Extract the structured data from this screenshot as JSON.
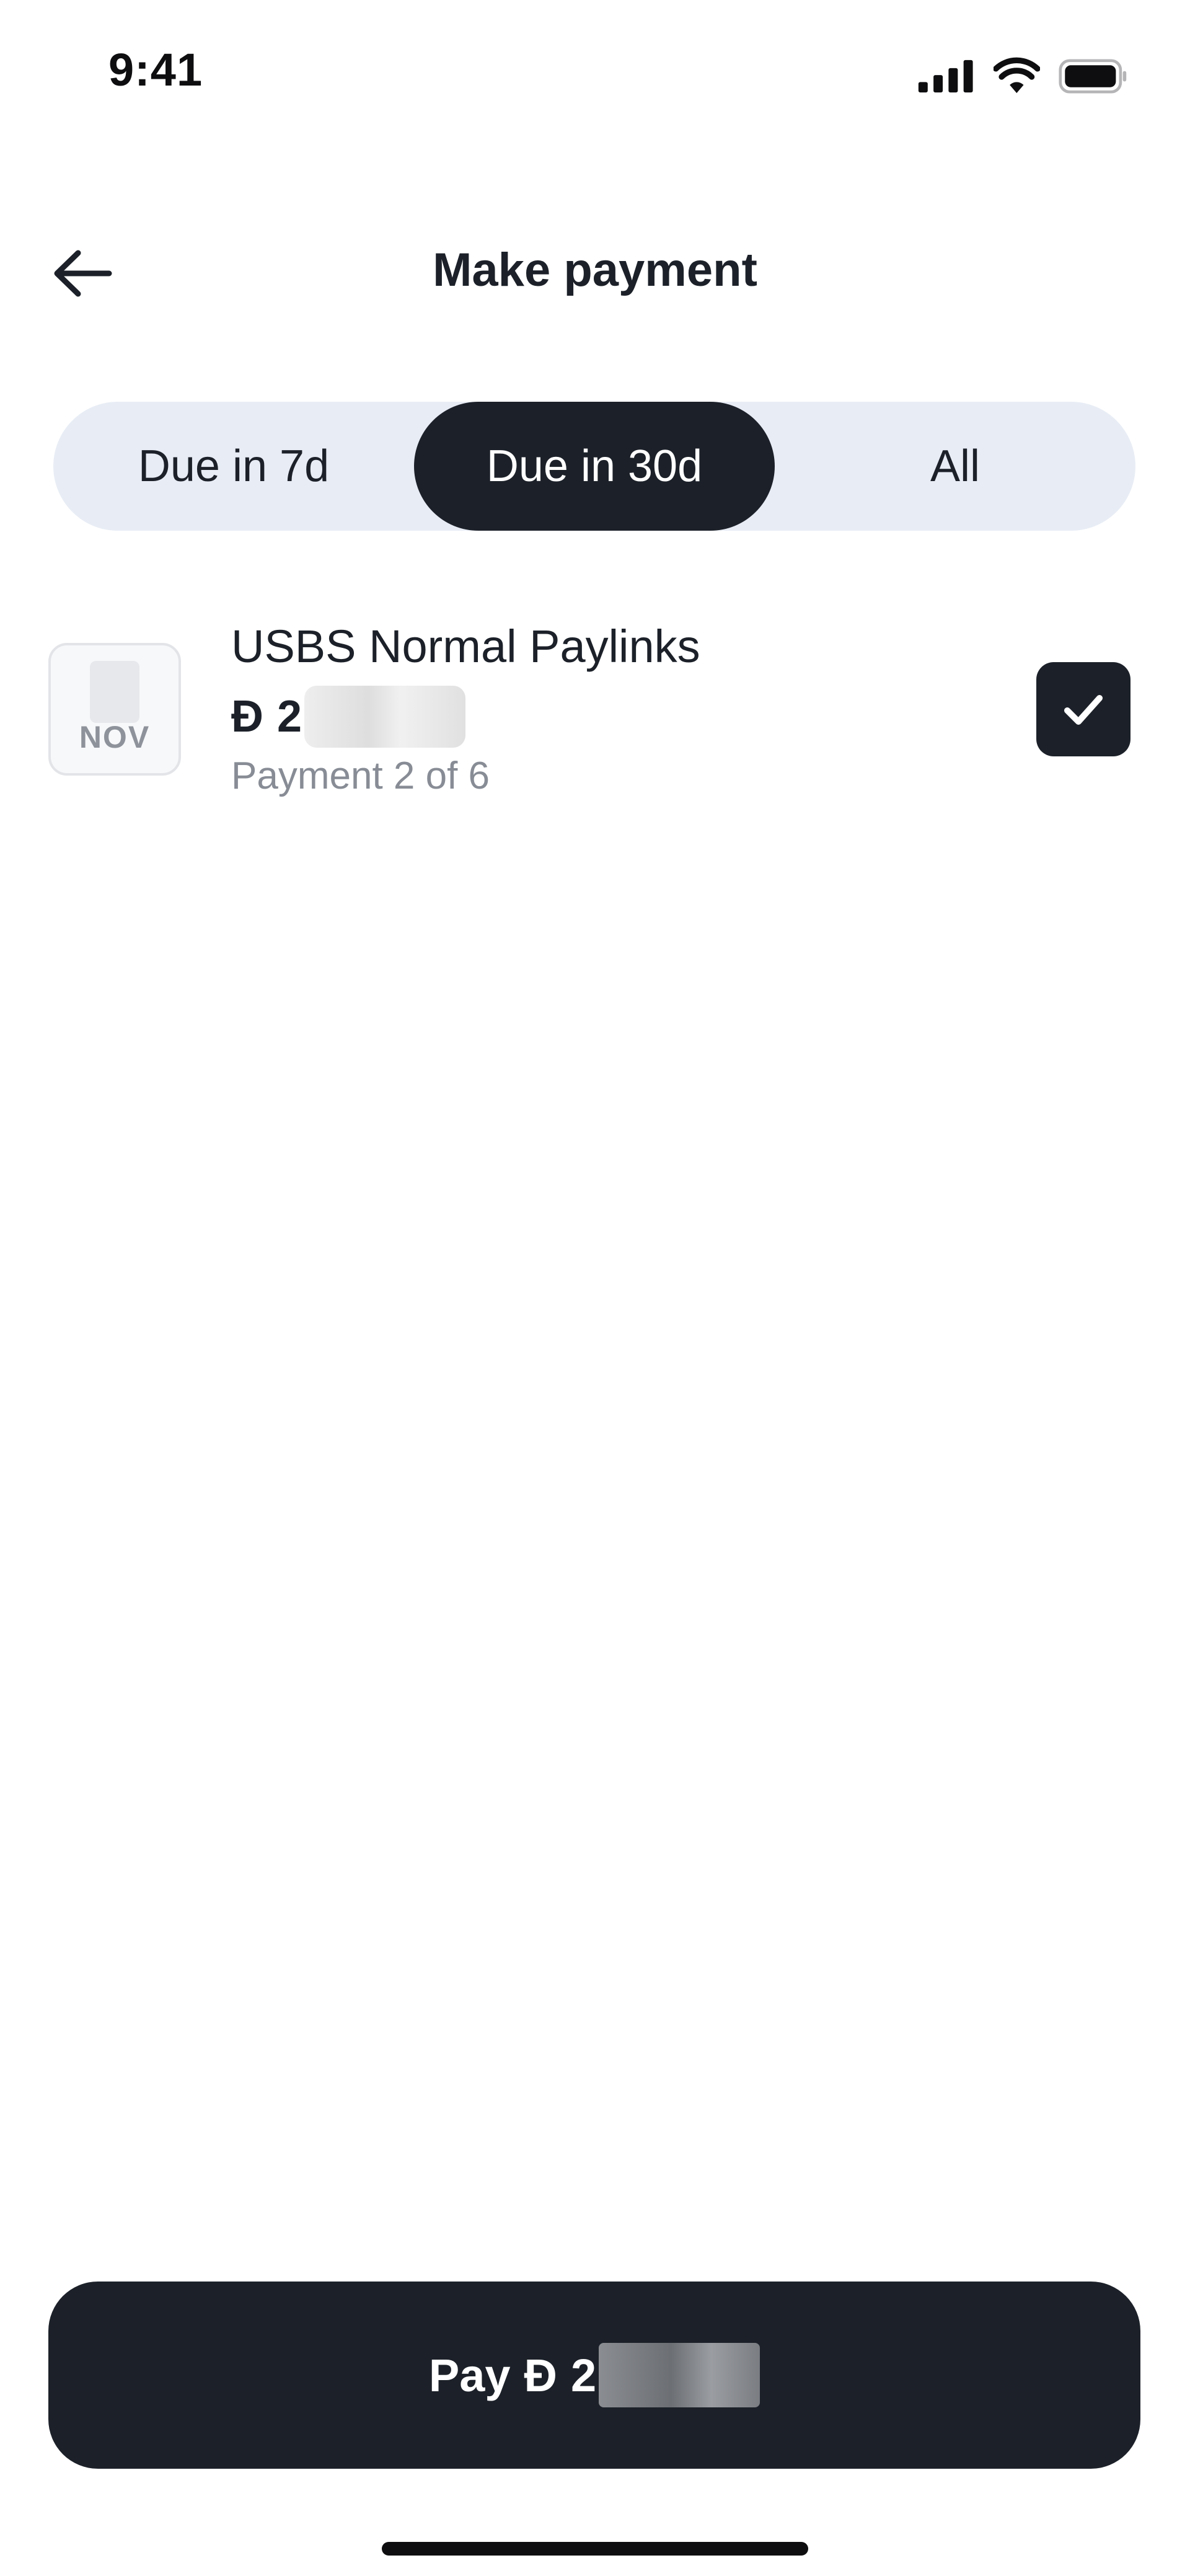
{
  "status_bar": {
    "time": "9:41"
  },
  "header": {
    "title": "Make payment",
    "back_icon": "arrow-left-icon"
  },
  "filters": {
    "tabs": [
      {
        "label": "Due in 7d",
        "selected": false
      },
      {
        "label": "Due in 30d",
        "selected": true
      },
      {
        "label": "All",
        "selected": false
      }
    ]
  },
  "payments": [
    {
      "month": "NOV",
      "name": "USBS Normal Paylinks",
      "currency_symbol": "Đ",
      "amount_prefix": "2",
      "subtitle": "Payment 2 of 6",
      "checked": true
    }
  ],
  "footer": {
    "pay_label": "Pay",
    "currency_symbol": "Đ",
    "amount_prefix": "2"
  },
  "colors": {
    "primary": "#1C2129",
    "segmented_bg": "#E8EDF5",
    "muted_text": "#878C95",
    "background": "#FFFFFF"
  }
}
